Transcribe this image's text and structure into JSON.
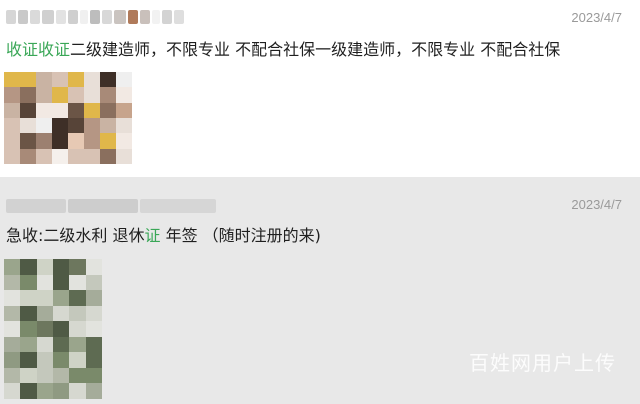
{
  "posts": [
    {
      "date": "2023/4/7",
      "text_highlight": "收证收证",
      "text_rest": "二级建造师，不限专业 不配合社保一级建造师，不限专业 不配合社保"
    },
    {
      "date": "2023/4/7",
      "text_pre": "急收:二级水利 退休",
      "text_highlight": "证",
      "text_post": " 年签 （随时注册的来)"
    }
  ],
  "watermark": "百姓网用户上传",
  "colors": {
    "highlight": "#3aa757",
    "timestamp": "#9a9a9a",
    "post_alt_background": "#e8e8e8"
  }
}
